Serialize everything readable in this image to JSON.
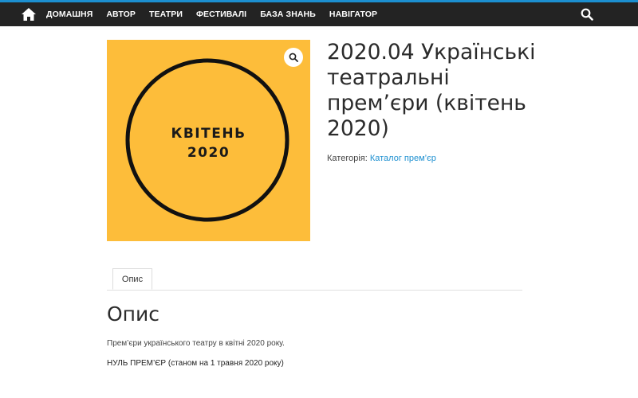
{
  "header": {
    "nav": [
      {
        "label": "ДОМАШНЯ"
      },
      {
        "label": "АВТОР"
      },
      {
        "label": "ТЕАТРИ"
      },
      {
        "label": "ФЕСТИВАЛІ"
      },
      {
        "label": "БАЗА ЗНАНЬ"
      },
      {
        "label": "НАВІГАТОР"
      }
    ],
    "home_icon": "home-icon",
    "search_icon": "search-icon"
  },
  "product": {
    "image": {
      "line1": "КВІТЕНЬ",
      "line2": "2020",
      "background": "#fdbd3a"
    },
    "zoom_icon": "magnifier-icon",
    "title": "2020.04 Українські театральні прем’єри (квітень 2020)",
    "category_label": "Категорія:",
    "category_link": "Каталог прем’єр"
  },
  "tabs": [
    {
      "label": "Опис"
    }
  ],
  "description": {
    "heading": "Опис",
    "paragraph1": "Прем’єри українського театру в квітні 2020 року.",
    "paragraph2": "НУЛЬ ПРЕМ’ЄР (станом на 1 травня 2020 року)"
  },
  "colors": {
    "topbar": "#232323",
    "accent": "#1c8fd0",
    "image_bg": "#fdbd3a"
  }
}
